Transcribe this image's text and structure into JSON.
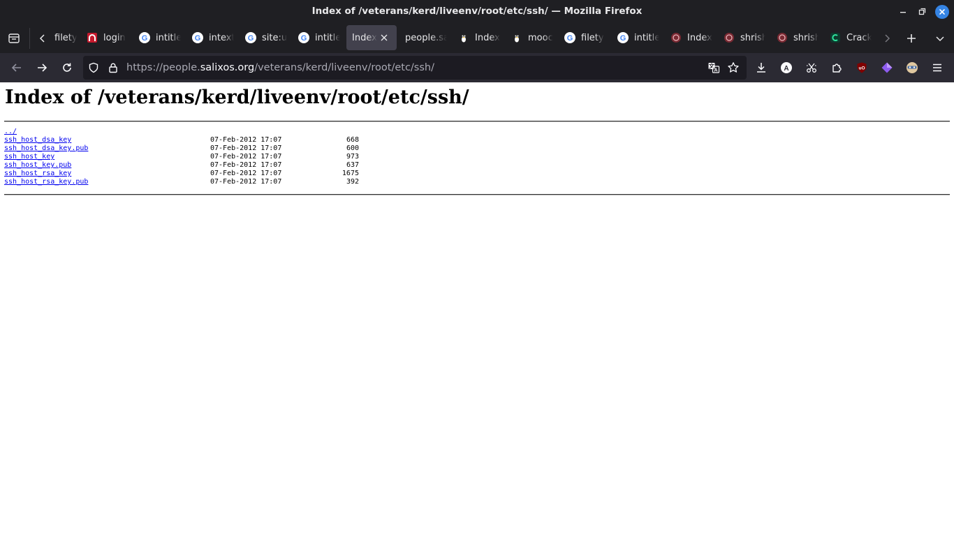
{
  "window": {
    "title": "Index of /veterans/kerd/liveenv/root/etc/ssh/ — Mozilla Firefox"
  },
  "tabs": [
    {
      "label": "filety",
      "icon": "none"
    },
    {
      "label": "login",
      "icon": "red-arch-favicon"
    },
    {
      "label": "intitle",
      "icon": "google-g-icon"
    },
    {
      "label": "intext",
      "icon": "google-g-icon"
    },
    {
      "label": "site:u",
      "icon": "google-g-icon"
    },
    {
      "label": "intitle",
      "icon": "google-g-icon"
    },
    {
      "label": "Index c",
      "icon": "none",
      "active": true
    },
    {
      "label": "people.sa",
      "icon": "none"
    },
    {
      "label": "Index",
      "icon": "tux-penguin-icon"
    },
    {
      "label": "mooc",
      "icon": "tux-penguin-icon"
    },
    {
      "label": "filety",
      "icon": "google-g-icon"
    },
    {
      "label": "intitle",
      "icon": "google-g-icon"
    },
    {
      "label": "Index",
      "icon": "red-emblem-icon"
    },
    {
      "label": "shrish",
      "icon": "red-emblem-icon"
    },
    {
      "label": "shrish",
      "icon": "red-emblem-icon"
    },
    {
      "label": "Crack",
      "icon": "green-c-icon"
    }
  ],
  "navbar": {
    "url_prefix": "https://people.",
    "url_host": "salixos.org",
    "url_path": "/veterans/kerd/liveenv/root/etc/ssh/"
  },
  "page": {
    "heading": "Index of /veterans/kerd/liveenv/root/etc/ssh/",
    "parent_link": "../",
    "entries": [
      {
        "name": "ssh_host_dsa_key",
        "date": "07-Feb-2012 17:07",
        "size": "668"
      },
      {
        "name": "ssh_host_dsa_key.pub",
        "date": "07-Feb-2012 17:07",
        "size": "600"
      },
      {
        "name": "ssh_host_key",
        "date": "07-Feb-2012 17:07",
        "size": "973"
      },
      {
        "name": "ssh_host_key.pub",
        "date": "07-Feb-2012 17:07",
        "size": "637"
      },
      {
        "name": "ssh_host_rsa_key",
        "date": "07-Feb-2012 17:07",
        "size": "1675"
      },
      {
        "name": "ssh_host_rsa_key.pub",
        "date": "07-Feb-2012 17:07",
        "size": "392"
      }
    ]
  },
  "colors": {
    "chrome_bg": "#1f1f23",
    "navbar_bg": "#2b2a33",
    "urlbar_bg": "#1c1b22",
    "active_tab_bg": "#42414d",
    "link": "#0000ee",
    "window_close": "#3584e4"
  }
}
